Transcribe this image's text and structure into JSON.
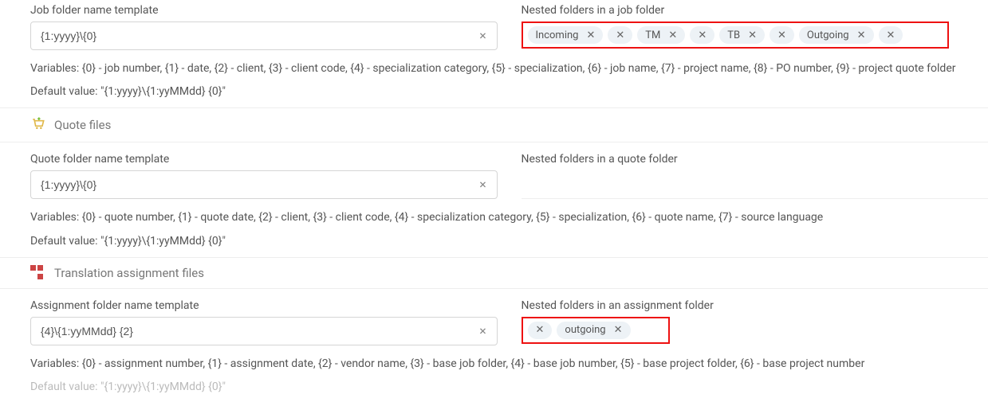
{
  "job": {
    "folder_label": "Job folder name template",
    "folder_value": "{1:yyyy}\\{0}",
    "nested_label": "Nested folders in a job folder",
    "tags": [
      "Incoming",
      "",
      "TM",
      "",
      "TB",
      "",
      "Outgoing",
      ""
    ],
    "variables": "Variables: {0} - job number, {1} - date, {2} - client, {3} - client code, {4} - specialization category, {5} - specialization, {6} - job name, {7} - project name, {8} - PO number, {9} - project quote folder",
    "default": "Default value: \"{1:yyyy}\\{1:yyMMdd} {0}\""
  },
  "quote": {
    "section_title": "Quote files",
    "folder_label": "Quote folder name template",
    "folder_value": "{1:yyyy}\\{0}",
    "nested_label": "Nested folders in a quote folder",
    "variables": "Variables: {0} - quote number, {1} - quote date, {2} - client, {3} - client code, {4} - specialization category, {5} - specialization, {6} - quote name, {7} - source language",
    "default": "Default value: \"{1:yyyy}\\{1:yyMMdd} {0}\""
  },
  "assignment": {
    "section_title": "Translation assignment files",
    "folder_label": "Assignment folder name template",
    "folder_value": "{4}\\{1:yyMMdd} {2}",
    "nested_label": "Nested folders in an assignment folder",
    "tags": [
      "outgoing"
    ],
    "variables": "Variables: {0} - assignment number, {1} - assignment date, {2} - vendor name, {3} - base job folder, {4} - base job number, {5} - base project folder, {6} - base project number",
    "default": "Default value: \"{1:yyyy}\\{1:yyMMdd} {0}\""
  },
  "glyphs": {
    "x": "×",
    "x_small": "✕"
  }
}
